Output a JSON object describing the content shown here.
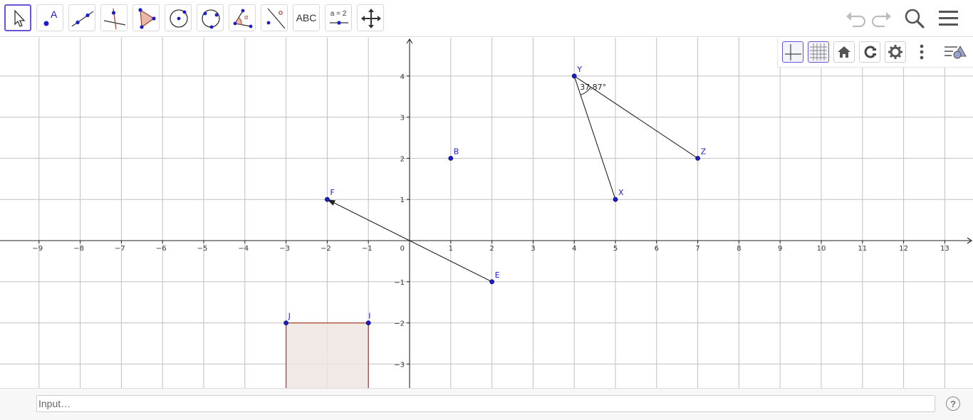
{
  "toolbar": {
    "tools": [
      {
        "name": "move-tool",
        "icon": "cursor-arrow-icon",
        "selected": true
      },
      {
        "name": "point-tool",
        "icon": "point-A-icon",
        "label": "A"
      },
      {
        "name": "line-tool",
        "icon": "line-through-points-icon"
      },
      {
        "name": "perpendicular-line-tool",
        "icon": "perpendicular-line-icon"
      },
      {
        "name": "polygon-tool",
        "icon": "polygon-icon"
      },
      {
        "name": "circle-center-point-tool",
        "icon": "circle-center-point-icon"
      },
      {
        "name": "circle-three-points-tool",
        "icon": "circle-three-points-icon"
      },
      {
        "name": "angle-tool",
        "icon": "angle-icon",
        "label": "α"
      },
      {
        "name": "reflect-line-tool",
        "icon": "reflect-about-line-icon"
      },
      {
        "name": "text-tool",
        "icon": "text-icon",
        "label": "ABC"
      },
      {
        "name": "slider-tool",
        "icon": "slider-icon",
        "label": "a = 2"
      },
      {
        "name": "move-graphics-view-tool",
        "icon": "move-view-arrows-icon"
      }
    ],
    "right_icons": [
      "undo-icon",
      "redo-icon",
      "search-icon",
      "menu-icon"
    ]
  },
  "style_bar": {
    "buttons": [
      {
        "name": "toggle-axes",
        "icon": "axes-icon",
        "active": true
      },
      {
        "name": "toggle-grid",
        "icon": "grid-icon",
        "active": true
      },
      {
        "name": "standard-view",
        "icon": "home-icon",
        "active": false
      },
      {
        "name": "point-capturing",
        "icon": "point-capture-icon",
        "active": false
      },
      {
        "name": "graphics-settings",
        "icon": "gear-icon",
        "active": false
      },
      {
        "name": "more-options",
        "icon": "vertical-dots-icon",
        "active": false
      },
      {
        "name": "close-style-bar",
        "icon": "style-bar-toggle-icon",
        "active": false
      }
    ]
  },
  "graphics": {
    "x_tick_labels": [
      "−9",
      "−8",
      "−7",
      "−6",
      "−5",
      "−4",
      "−3",
      "−2",
      "−1",
      "1",
      "2",
      "3",
      "4",
      "5",
      "6",
      "7",
      "8",
      "9",
      "10",
      "11",
      "12",
      "13"
    ],
    "y_tick_labels": [
      "4",
      "3",
      "2",
      "1",
      "−1",
      "−2",
      "−3"
    ],
    "origin_label": "0",
    "points": [
      {
        "label": "B",
        "x": 1,
        "y": 2
      },
      {
        "label": "F",
        "x": -2,
        "y": 1
      },
      {
        "label": "E",
        "x": 2,
        "y": -1
      },
      {
        "label": "Y",
        "x": 4,
        "y": 4
      },
      {
        "label": "X",
        "x": 5,
        "y": 1
      },
      {
        "label": "Z",
        "x": 7,
        "y": 2
      },
      {
        "label": "J",
        "x": -3,
        "y": -2
      },
      {
        "label": "I",
        "x": -1,
        "y": -2
      }
    ],
    "angle_label": "37.87°",
    "colors": {
      "point": "#1c1ccc",
      "grid": "#c0c0c0",
      "axis": "#222222",
      "polygon_fill": "#efe5e0",
      "polygon_edge": "#a3402e"
    }
  },
  "input_bar": {
    "placeholder": "Input…"
  },
  "help": {
    "label": "?"
  }
}
